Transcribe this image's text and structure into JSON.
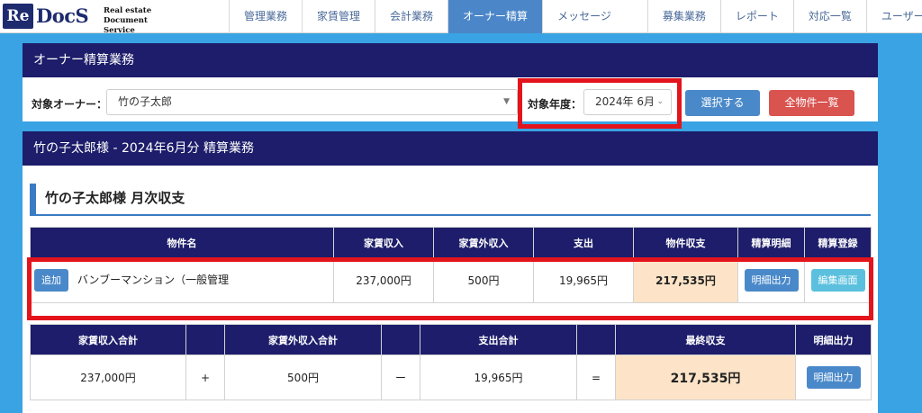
{
  "brand": {
    "logo_mark": "Re",
    "logo_word": "DocS",
    "tagline_line1": "Real estate",
    "tagline_line2": "Document Service"
  },
  "nav": {
    "items": [
      {
        "label": "管理業務"
      },
      {
        "label": "家賃管理"
      },
      {
        "label": "会計業務"
      },
      {
        "label": "オーナー精算"
      },
      {
        "label": "メッセージ"
      },
      {
        "label": "募集業務"
      },
      {
        "label": "レポート"
      },
      {
        "label": "対応一覧"
      },
      {
        "label": "ユーザー設定"
      }
    ],
    "active_index": 3
  },
  "panel1": {
    "title": "オーナー精算業務",
    "owner_label": "対象オーナー：",
    "owner_value": "竹の子太郎",
    "year_label": "対象年度：",
    "year_value": "2024年 6月",
    "select_button": "選択する",
    "all_button": "全物件一覧"
  },
  "panel2": {
    "title": "竹の子太郎様 - 2024年6月分 精算業務",
    "section_title": "竹の子太郎様 月次収支",
    "table1": {
      "headers": [
        "物件名",
        "家賃収入",
        "家賃外収入",
        "支出",
        "物件収支",
        "精算明細",
        "精算登録"
      ],
      "rows": [
        {
          "add_button": "追加",
          "property": "バンブーマンション（一般管理",
          "rent": "237,000円",
          "other_income": "500円",
          "expense": "19,965円",
          "balance": "217,535円",
          "detail_button": "明細出力",
          "edit_button": "編集画面"
        }
      ]
    },
    "table2": {
      "headers": [
        "家賃収入合計",
        "",
        "家賃外収入合計",
        "",
        "支出合計",
        "",
        "最終収支",
        "明細出力"
      ],
      "values": {
        "rent_total": "237,000円",
        "op1": "+",
        "other_total": "500円",
        "op2": "ー",
        "expense_total": "19,965円",
        "op3": "=",
        "final_balance": "217,535円",
        "detail_button": "明細出力"
      }
    }
  },
  "colors": {
    "navy": "#1d1d6b",
    "accent_blue": "#4a89c9",
    "danger_red": "#d9534f",
    "highlight_red": "#e4141c",
    "peach": "#fde4c8"
  }
}
